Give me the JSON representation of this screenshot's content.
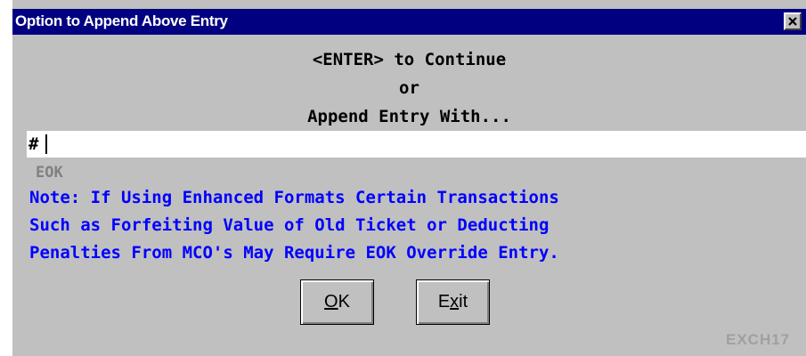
{
  "window": {
    "title": "Option to Append Above Entry",
    "close_icon": "close-icon"
  },
  "prompt": {
    "line1": "<ENTER> to Continue",
    "line2": "or",
    "line3": "Append Entry With..."
  },
  "entry": {
    "value": "#"
  },
  "hint": {
    "text": "EOK"
  },
  "note": {
    "lines": [
      "Note: If Using Enhanced Formats Certain Transactions",
      "Such as Forfeiting Value of Old Ticket or Deducting",
      "Penalties From MCO's May Require EOK Override Entry."
    ],
    "color": "#0000ff"
  },
  "buttons": {
    "ok": {
      "mnemonic": "O",
      "rest": "K"
    },
    "exit": {
      "pre": "E",
      "mnemonic": "x",
      "rest": "it"
    }
  },
  "screen_id": "EXCH17",
  "colors": {
    "titlebar": "#000080",
    "dialog_bg": "#c0c0c0",
    "hint": "#808080"
  }
}
